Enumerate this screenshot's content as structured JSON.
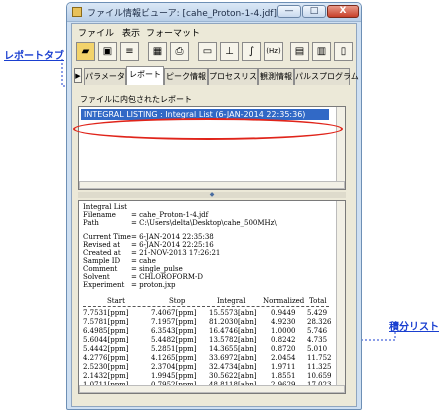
{
  "window": {
    "title": "ファイル情報ビューア: [cahe_Proton-1-4.jdf]",
    "minimize": "—",
    "maximize": "□",
    "close": "X"
  },
  "menu": [
    "ファイル",
    "表示",
    "フォーマット"
  ],
  "toolbar": {
    "icons": [
      "folder-open-icon",
      "image-icon",
      "list-icon",
      "save-icon",
      "print-icon",
      "screen-icon",
      "peak-icon",
      "integral-icon",
      "hz-icon",
      "table-icon",
      "grid-icon",
      "document-icon"
    ],
    "hz_label": "(Hz)"
  },
  "tabs": [
    {
      "label": "パラメータ",
      "active": false
    },
    {
      "label": "レポート",
      "active": true
    },
    {
      "label": "ピーク情報",
      "active": false
    },
    {
      "label": "プロセスリスト",
      "active": false
    },
    {
      "label": "観測情報",
      "active": false
    },
    {
      "label": "パルスプログラム",
      "active": false
    }
  ],
  "reports_section_label": "ファイルに内包されたレポート",
  "reports": [
    "INTEGRAL LISTING : Integral List  (6-JAN-2014 22:35:36)"
  ],
  "report_text": {
    "heading": "Integral List",
    "fields": [
      {
        "key": "Filename",
        "value": "= cahe_Proton-1-4.jdf"
      },
      {
        "key": "Path",
        "value": "= C:\\Users\\delta\\Desktop\\cahe_500MHz\\"
      },
      {
        "key": "Current Time",
        "value": "= 6-JAN-2014 22:35:38"
      },
      {
        "key": "Revised at",
        "value": "= 6-JAN-2014 22:25:16"
      },
      {
        "key": "Created at",
        "value": "= 21-NOV-2013 17:26:21"
      },
      {
        "key": "Sample ID",
        "value": "= cahe"
      },
      {
        "key": "Comment",
        "value": "= single_pulse"
      },
      {
        "key": "Solvent",
        "value": "= CHLOROFORM-D"
      },
      {
        "key": "Experiment",
        "value": "= proton.jxp"
      }
    ],
    "columns": [
      "Start",
      "Stop",
      "Integral",
      "Normalized",
      "Total"
    ],
    "rows": [
      [
        "7.7531[ppm]",
        "7.4067[ppm]",
        "15.5573[abn]",
        "0.9449",
        "5.429"
      ],
      [
        "7.5781[ppm]",
        "7.1957[ppm]",
        "81.2030[abn]",
        "4.9230",
        "28.326"
      ],
      [
        "6.4985[ppm]",
        "6.3543[ppm]",
        "16.4746[abn]",
        "1.0000",
        "5.746"
      ],
      [
        "5.6044[ppm]",
        "5.4482[ppm]",
        "13.5782[abn]",
        "0.8242",
        "4.735"
      ],
      [
        "5.4442[ppm]",
        "5.2851[ppm]",
        "14.3655[abn]",
        "0.8720",
        "5.010"
      ],
      [
        "4.2776[ppm]",
        "4.1265[ppm]",
        "33.6972[abn]",
        "2.0454",
        "11.752"
      ],
      [
        "2.5230[ppm]",
        "2.3704[ppm]",
        "32.4734[abn]",
        "1.9711",
        "11.325"
      ],
      [
        "2.1432[ppm]",
        "1.9945[ppm]",
        "30.5622[abn]",
        "1.8551",
        "10.659"
      ],
      [
        "1.0711[ppm]",
        "0.7952[ppm]",
        "48.8118[abn]",
        "2.9629",
        "17.023"
      ]
    ]
  },
  "callouts": {
    "report_tab": "レポートタブ",
    "integral_list": "積分リスト"
  },
  "colors": {
    "highlight_oval": "#e0241a",
    "callout_text": "#1a3fd0",
    "selection": "#3169c6"
  }
}
